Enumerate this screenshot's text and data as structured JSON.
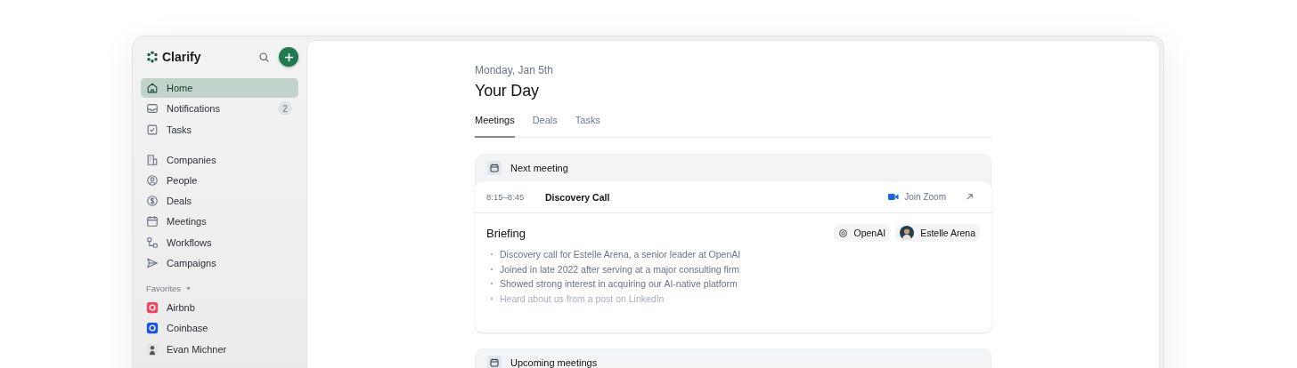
{
  "brand": {
    "name": "Clarify"
  },
  "nav_groups": [
    [
      {
        "label": "Home",
        "kind": "home",
        "selected": true
      },
      {
        "label": "Notifications",
        "kind": "inbox",
        "selected": false,
        "count": "2"
      },
      {
        "label": "Tasks",
        "kind": "check",
        "selected": false
      }
    ],
    [
      {
        "label": "Companies",
        "kind": "building",
        "selected": false
      },
      {
        "label": "People",
        "kind": "person",
        "selected": false
      },
      {
        "label": "Deals",
        "kind": "dollar",
        "selected": false
      },
      {
        "label": "Meetings",
        "kind": "calendar",
        "selected": false
      },
      {
        "label": "Workflows",
        "kind": "flow",
        "selected": false
      },
      {
        "label": "Campaigns",
        "kind": "send",
        "selected": false
      }
    ]
  ],
  "favorites": {
    "label": "Favorites",
    "expanded": true,
    "items": [
      {
        "label": "Airbnb",
        "kind": "company",
        "color": "#f0455e"
      },
      {
        "label": "Coinbase",
        "kind": "company",
        "color": "#1652f0"
      },
      {
        "label": "Evan Michner",
        "kind": "person"
      }
    ]
  },
  "date": "Monday, Jan 5th",
  "title": "Your Day",
  "tabs": [
    {
      "label": "Meetings",
      "selected": true
    },
    {
      "label": "Deals",
      "selected": false
    },
    {
      "label": "Tasks",
      "selected": false
    }
  ],
  "next_meeting": {
    "heading": "Next meeting",
    "time": "8:15–8:45",
    "name": "Discovery Call",
    "join": "Join Zoom",
    "briefing": {
      "title": "Briefing",
      "chips": [
        {
          "label": "OpenAI",
          "kind": "company"
        },
        {
          "label": "Estelle Arena",
          "kind": "person"
        }
      ],
      "bullets": [
        "Discovery call for Estelle Arena, a senior leader at OpenAI",
        "Joined in late 2022 after serving at a major consulting firm",
        "Showed strong interest in acquiring our AI-native platform",
        "Heard about us from a post on LinkedIn"
      ]
    }
  },
  "upcoming": {
    "heading": "Upcoming meetings"
  }
}
